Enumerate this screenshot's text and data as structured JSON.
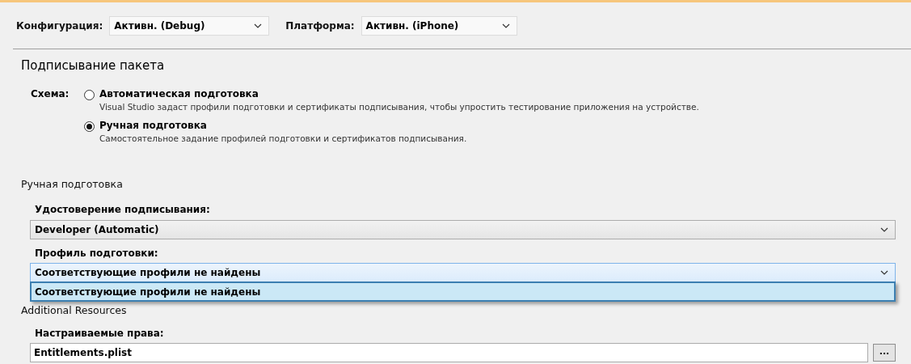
{
  "toolbar": {
    "configuration": {
      "label": "Конфигурация:",
      "value": "Активн. (Debug)"
    },
    "platform": {
      "label": "Платформа:",
      "value": "Активн. (iPhone)"
    }
  },
  "section_title": "Подписывание пакета",
  "scheme": {
    "label": "Схема:",
    "options": [
      {
        "label": "Автоматическая подготовка",
        "description": "Visual Studio задаст профили подготовки и сертификаты подписывания, чтобы упростить тестирование приложения на устройстве.",
        "selected": false
      },
      {
        "label": "Ручная подготовка",
        "description": "Самостоятельное задание профилей подготовки и сертификатов подписывания.",
        "selected": true
      }
    ]
  },
  "manual": {
    "title": "Ручная подготовка",
    "identity": {
      "label": "Удостоверение подписывания:",
      "value": "Developer (Automatic)"
    },
    "profile": {
      "label": "Профиль подготовки:",
      "value": "Соответствующие профили не найдены",
      "expanded": true,
      "options": [
        {
          "label": "Соответствующие профили не найдены",
          "selected": true
        }
      ]
    }
  },
  "additional": {
    "title": "Additional Resources",
    "entitlements": {
      "label": "Настраиваемые права:",
      "value": "Entitlements.plist",
      "browse": "..."
    }
  }
}
